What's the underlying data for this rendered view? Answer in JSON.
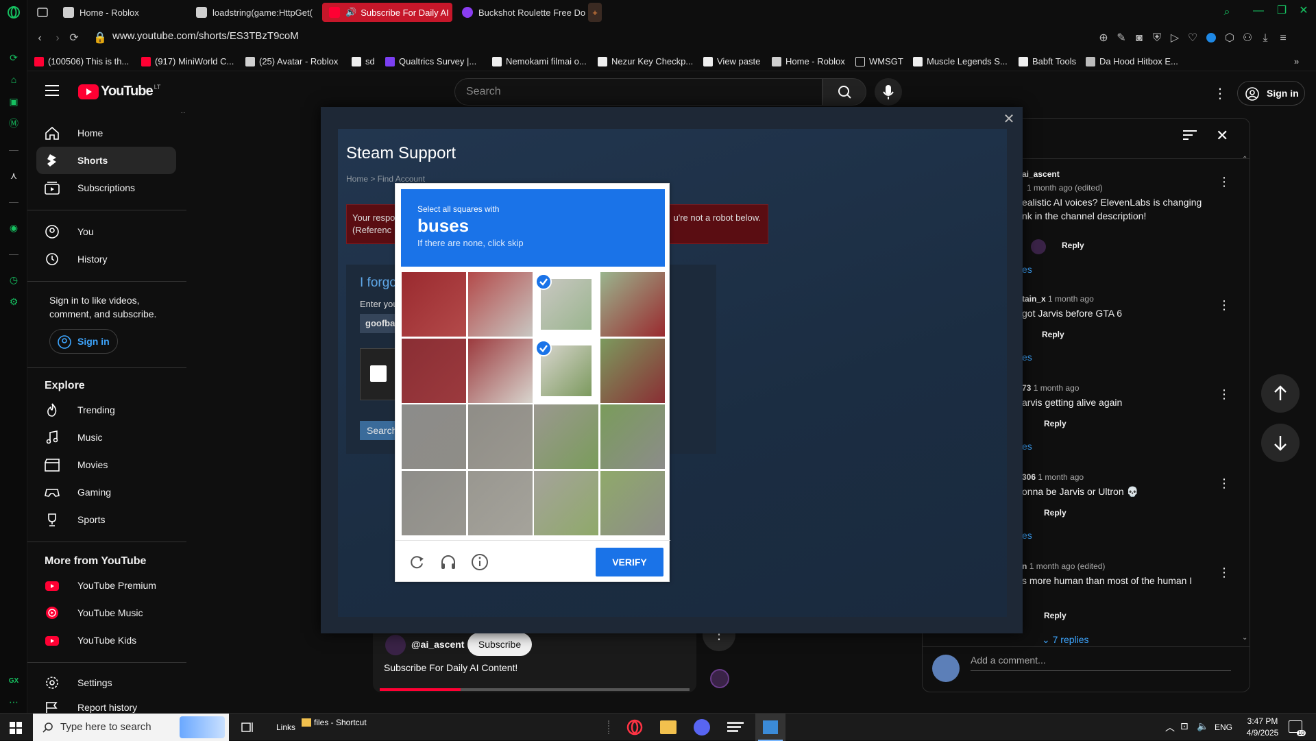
{
  "tabs": [
    {
      "label": "Home - Roblox",
      "color": "#cfcfcf"
    },
    {
      "label": "loadstring(game:HttpGet(",
      "color": "#cfcfcf"
    },
    {
      "label": "Subscribe For Daily AI",
      "color": "#ff0033"
    },
    {
      "label": "Buckshot Roulette Free Do",
      "color": "#8a3df0"
    }
  ],
  "address": {
    "url": "www.youtube.com/shorts/ES3TBzT9coM"
  },
  "bookmarks": [
    "(100506) This is th...",
    "(917) MiniWorld C...",
    "(25) Avatar - Roblox",
    "sd",
    "Qualtrics Survey |...",
    "Nemokami filmai o...",
    "Nezur Key Checkp...",
    "View paste",
    "Home - Roblox",
    "WMSGT",
    "Muscle Legends S...",
    "Babft Tools",
    "Da Hood Hitbox E..."
  ],
  "youtube": {
    "logo": "YouTube",
    "logo_region": "LT",
    "search_placeholder": "Search",
    "sign_in": "Sign in"
  },
  "sidebar": {
    "main": [
      "Home",
      "Shorts",
      "Subscriptions"
    ],
    "you": [
      "You",
      "History"
    ],
    "signin_prompt": "Sign in to like videos, comment, and subscribe.",
    "signin_button": "Sign in",
    "explore_heading": "Explore",
    "explore": [
      "Trending",
      "Music",
      "Movies",
      "Gaming",
      "Sports"
    ],
    "more_heading": "More from YouTube",
    "more": [
      "YouTube Premium",
      "YouTube Music",
      "YouTube Kids"
    ],
    "settings": [
      "Settings",
      "Report history"
    ]
  },
  "steam": {
    "title": "Steam Support",
    "breadcrumb": "Home > Find Account",
    "error_left": "Your respo",
    "error_left2": "(Referenc",
    "error_right": "u're not a robot below.",
    "forgot": "I forgo",
    "enter": "Enter you",
    "account_value": "goofba",
    "search_button": "Search"
  },
  "captcha": {
    "subtitle": "Select all squares with",
    "target": "buses",
    "hint": "If there are none, click skip",
    "verify": "VERIFY",
    "selected_tiles": [
      2,
      6
    ]
  },
  "comments": [
    {
      "author": "ai_ascent",
      "time": "1 month ago (edited)",
      "text": "ealistic AI voices? ElevenLabs is changing nk in the channel description!",
      "reply": "Reply",
      "replies": "es"
    },
    {
      "author": "tain_x",
      "time": "1 month ago",
      "text": "got Jarvis before GTA 6",
      "reply": "Reply",
      "replies": "es"
    },
    {
      "author": "73",
      "time": "1 month ago",
      "text": "arvis getting alive again",
      "reply": "Reply",
      "replies": "es"
    },
    {
      "author": "306",
      "time": "1 month ago",
      "text": "onna be Jarvis or Ultron 💀",
      "reply": "Reply",
      "replies": "es"
    },
    {
      "author": "n",
      "time": "1 month ago (edited)",
      "text": "s more human than most of the human I",
      "reply": "Reply",
      "replies": "7 replies"
    }
  ],
  "comment_input": {
    "placeholder": "Add a comment..."
  },
  "short": {
    "channel": "@ai_ascent",
    "subscribe": "Subscribe",
    "title": "Subscribe For Daily AI Content!",
    "progress": 0.26
  },
  "taskbar": {
    "search_placeholder": "Type here to search",
    "links": "Links",
    "files": "files - Shortcut",
    "lang": "ENG",
    "time": "3:47 PM",
    "date": "4/9/2025",
    "notif_count": "10"
  },
  "colors": {
    "accent": "#1a73e8",
    "yt_red": "#ff0033",
    "gx_green": "#16c060"
  }
}
